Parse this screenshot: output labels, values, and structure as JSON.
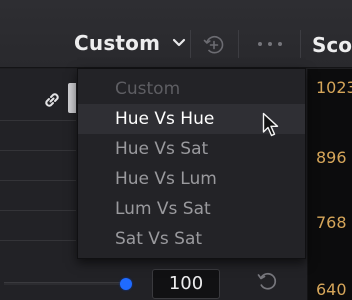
{
  "header": {
    "dropdown_label": "Custom",
    "scopes_label": "Scop"
  },
  "menu": {
    "items": [
      {
        "label": "Custom",
        "state": "disabled"
      },
      {
        "label": "Hue Vs Hue",
        "state": "selected"
      },
      {
        "label": "Hue Vs Sat",
        "state": "normal"
      },
      {
        "label": "Hue Vs Lum",
        "state": "normal"
      },
      {
        "label": "Lum Vs Sat",
        "state": "normal"
      },
      {
        "label": "Sat Vs Sat",
        "state": "normal"
      }
    ]
  },
  "controls": {
    "value": "100",
    "slider_level": 1.0
  },
  "scopes": {
    "values": [
      "1023",
      "896",
      "768",
      "640"
    ]
  },
  "icons": [
    "chevron-down-icon",
    "add-circle-icon",
    "more-options-icon",
    "link-icon",
    "reset-icon",
    "mouse-cursor-icon"
  ],
  "colors": {
    "accent_blue": "#1f6bff",
    "scope_value": "#d6a65a",
    "menu_selected_bg": "#2f2f34"
  }
}
